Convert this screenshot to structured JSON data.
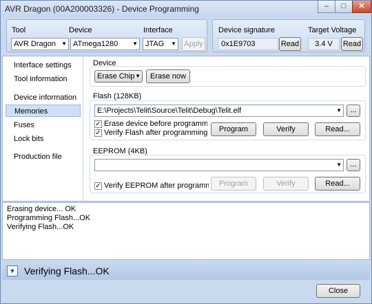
{
  "window": {
    "title": "AVR Dragon (00A200003326) - Device Programming",
    "min_glyph": "–",
    "max_glyph": "□",
    "close_glyph": "✕"
  },
  "toolbar": {
    "tool_label": "Tool",
    "tool_value": "AVR Dragon",
    "device_label": "Device",
    "device_value": "ATmega1280",
    "interface_label": "Interface",
    "interface_value": "JTAG",
    "apply_label": "Apply"
  },
  "signature": {
    "label": "Device signature",
    "value": "0x1E9703",
    "read_label": "Read"
  },
  "voltage": {
    "label": "Target Voltage",
    "value": "3.4 V",
    "read_label": "Read"
  },
  "nav": {
    "items": [
      {
        "label": "Interface settings"
      },
      {
        "label": "Tool information"
      },
      {
        "label": "Device information"
      },
      {
        "label": "Memories"
      },
      {
        "label": "Fuses"
      },
      {
        "label": "Lock bits"
      },
      {
        "label": "Production file"
      }
    ],
    "selected": "Memories"
  },
  "device_group": {
    "label": "Device",
    "erase_select": "Erase Chip",
    "erase_now_label": "Erase now"
  },
  "flash": {
    "label": "Flash (128KB)",
    "path": "E:\\Projects\\Telit\\Source\\Telit\\Debug\\Telit.elf",
    "browse_label": "...",
    "erase_before_label": "Erase device before programming",
    "verify_after_label": "Verify Flash after programming",
    "program_label": "Program",
    "verify_label": "Verify",
    "read_label": "Read..."
  },
  "eeprom": {
    "label": "EEPROM (4KB)",
    "path": "",
    "browse_label": "...",
    "verify_after_label": "Verify EEPROM after programming",
    "program_label": "Program",
    "verify_label": "Verify",
    "read_label": "Read..."
  },
  "log": {
    "lines": [
      {
        "text": "Erasing device... OK"
      },
      {
        "text": "Programming Flash...OK"
      },
      {
        "text": "Verifying Flash...OK"
      }
    ]
  },
  "status": {
    "text": "Verifying Flash...OK",
    "toggle_glyph": "▼"
  },
  "footer": {
    "close_label": "Close"
  },
  "colors": {
    "frame": "#c9d9ee",
    "nav_selected": "#cfe0f5"
  }
}
